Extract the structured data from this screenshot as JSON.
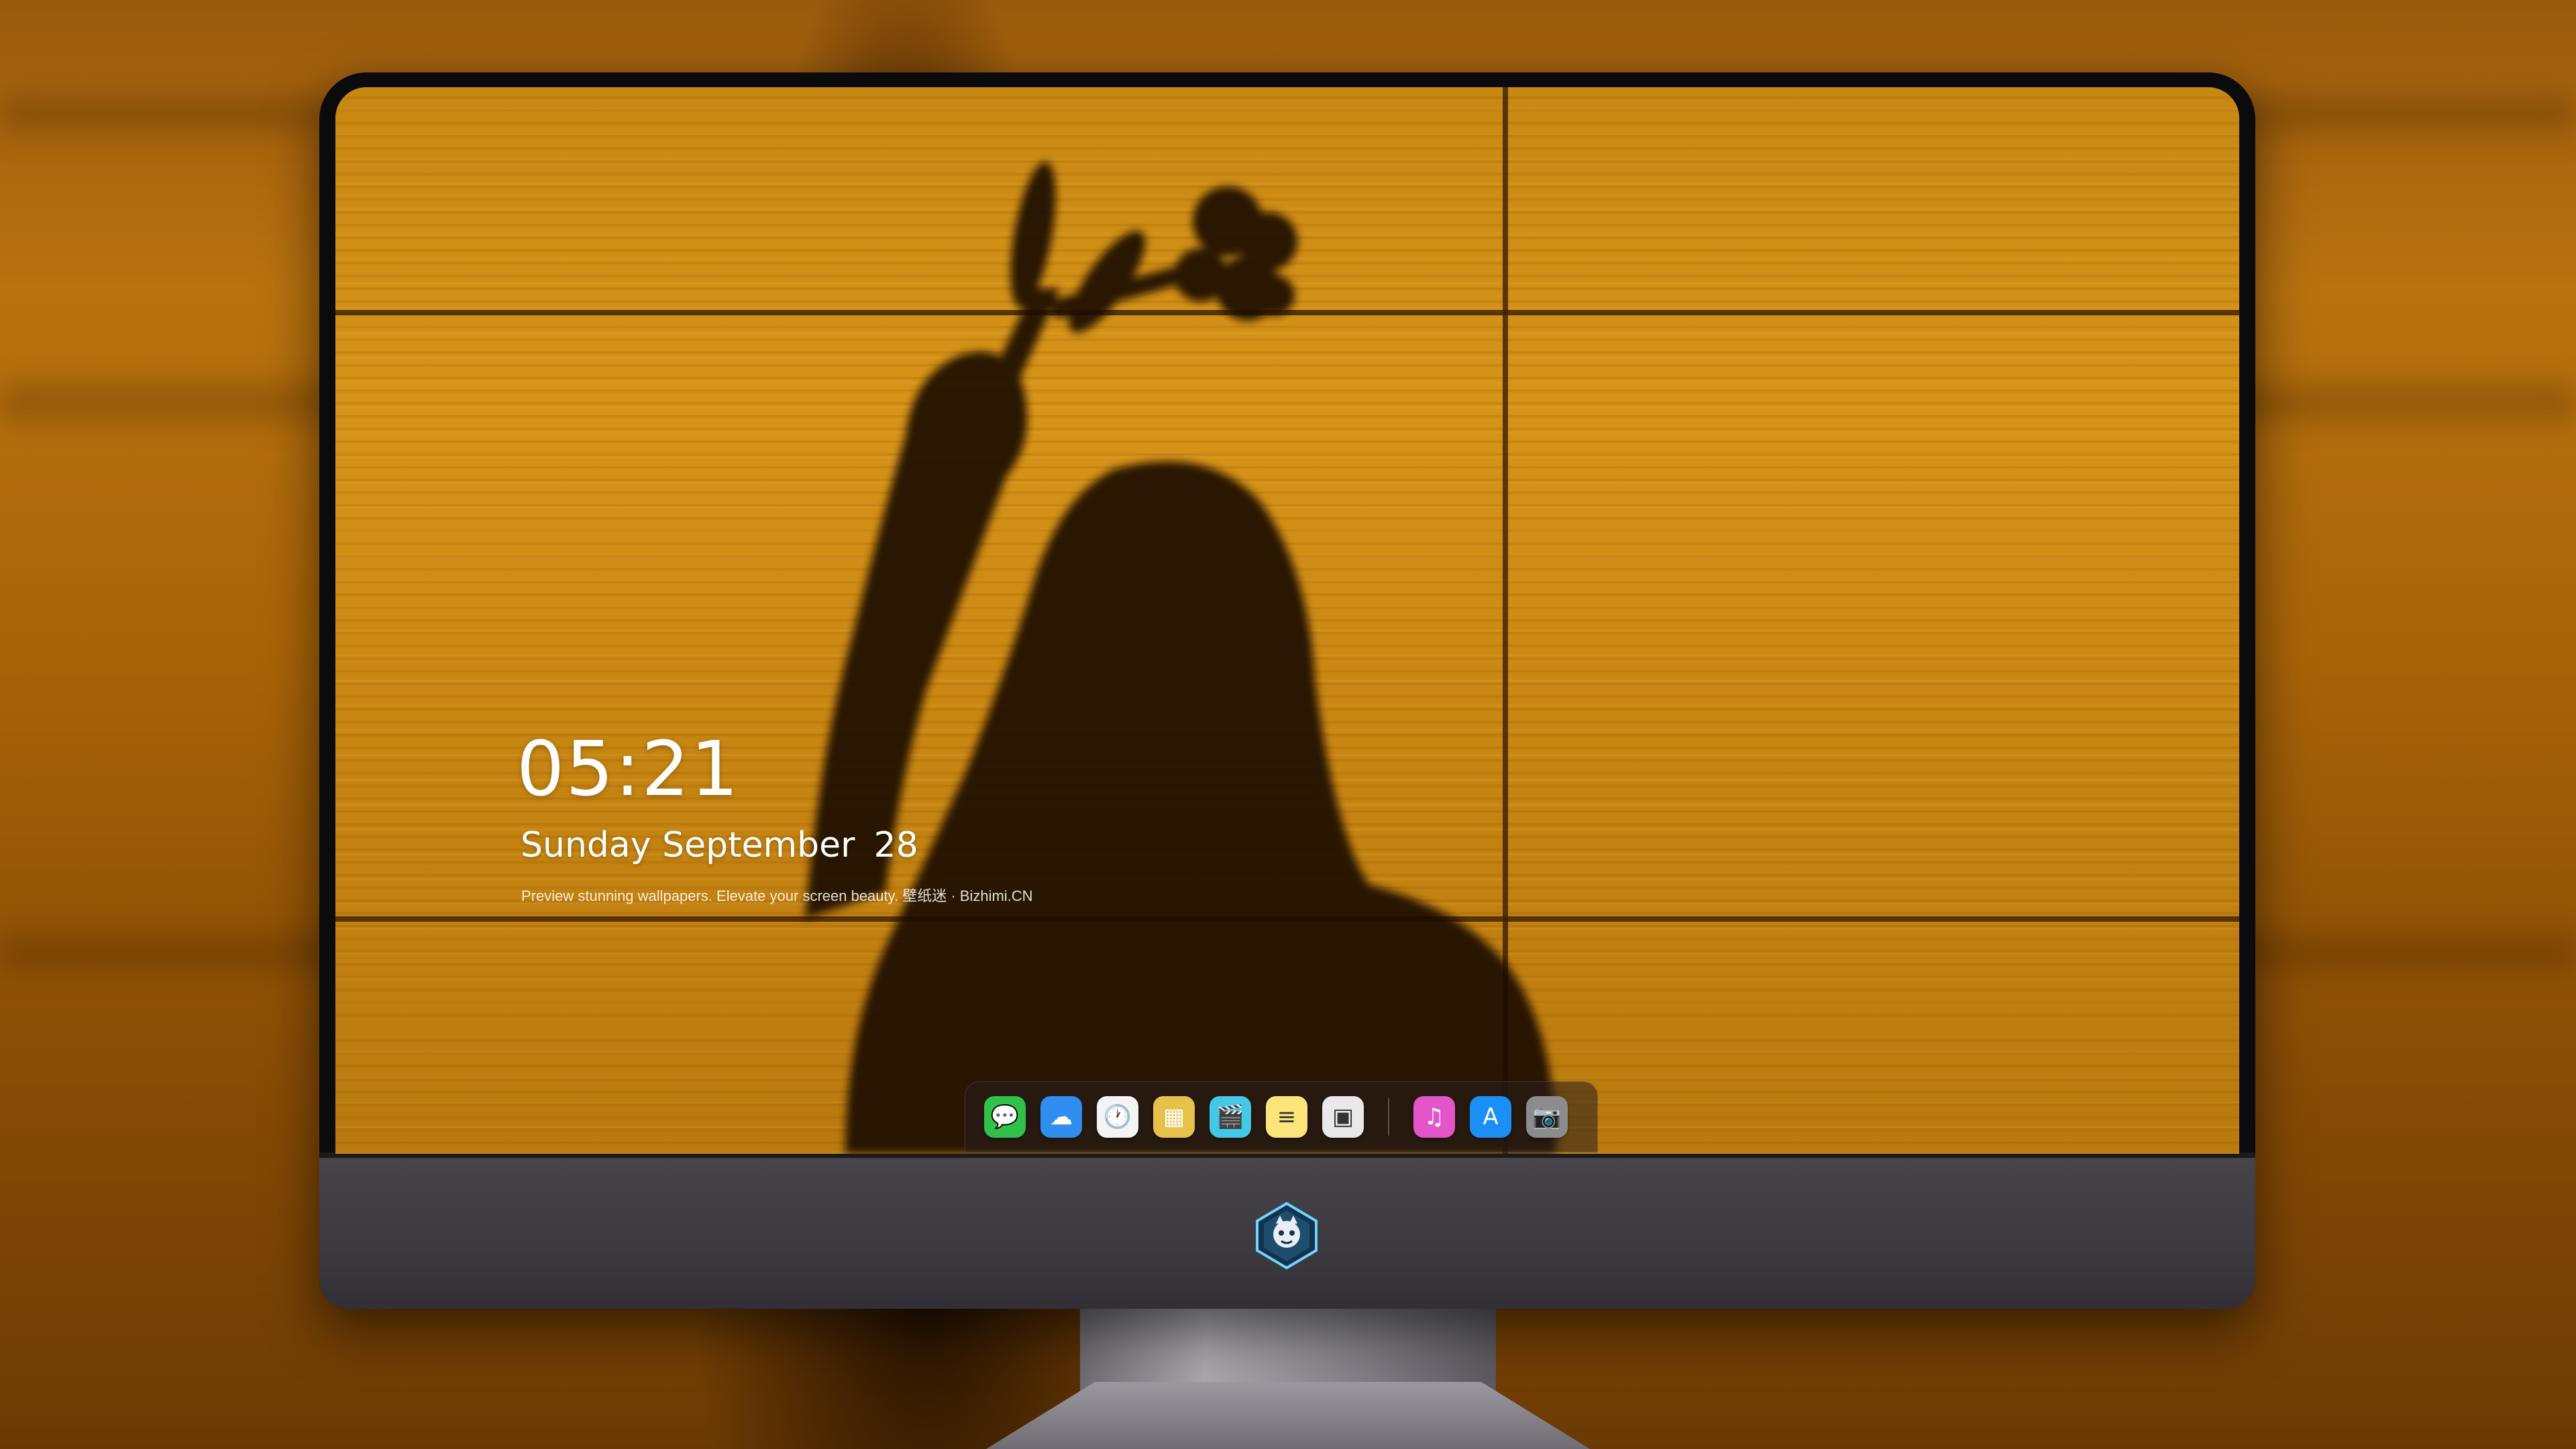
{
  "lockscreen": {
    "time": "05:21",
    "weekday": "Sunday",
    "month": "September",
    "day": "28",
    "tagline": "Preview stunning wallpapers. Elevate your screen beauty. 壁纸迷 · Bizhimi.CN"
  },
  "dock": {
    "apps": [
      {
        "name": "messages-icon",
        "glyph": "💬",
        "color": "#2fc14a"
      },
      {
        "name": "weather-icon",
        "glyph": "☁",
        "color": "#2f8ef0"
      },
      {
        "name": "clock-icon",
        "glyph": "🕐",
        "color": "#f4f4f4"
      },
      {
        "name": "preview-icon",
        "glyph": "▦",
        "color": "#e7c24a"
      },
      {
        "name": "clips-icon",
        "glyph": "🎬",
        "color": "#44c8e8"
      },
      {
        "name": "notes-icon",
        "glyph": "≡",
        "color": "#fbe47a"
      },
      {
        "name": "photo-booth-icon",
        "glyph": "▣",
        "color": "#e9e9e9"
      },
      {
        "name": "music-icon",
        "glyph": "♫",
        "color": "#e455c9"
      },
      {
        "name": "app-store-icon",
        "glyph": "A",
        "color": "#1a8ff5"
      },
      {
        "name": "camera-icon",
        "glyph": "📷",
        "color": "#8c8c8e"
      }
    ]
  },
  "colors": {
    "wall": "#d69418",
    "accent": "#ffffff"
  }
}
